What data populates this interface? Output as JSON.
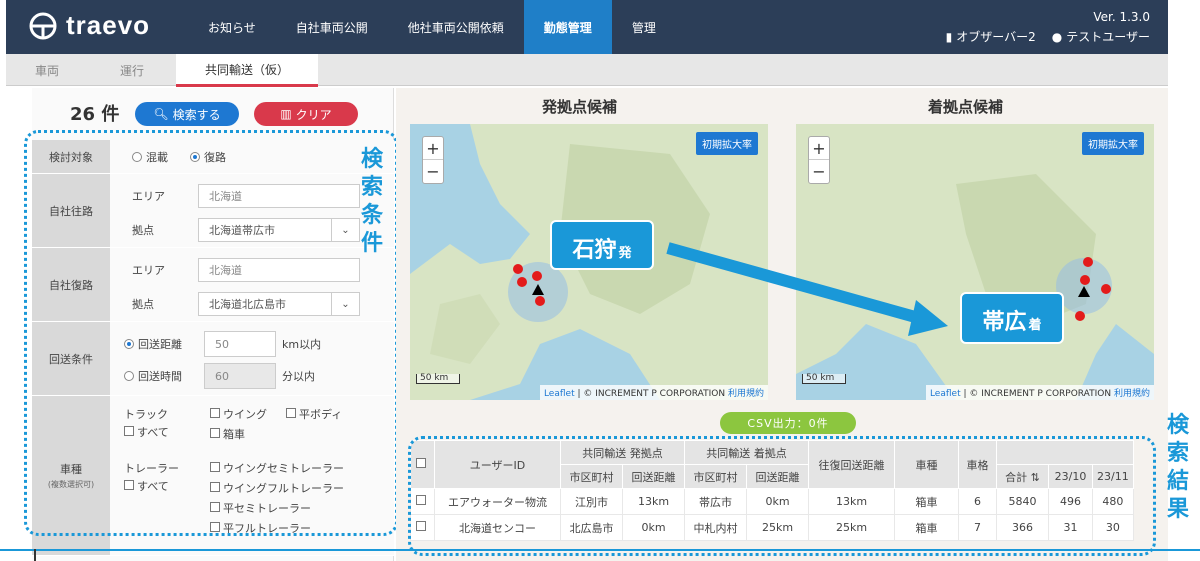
{
  "header": {
    "logo_text": "traevo",
    "version": "Ver. 1.3.0",
    "nav": [
      "お知らせ",
      "自社車両公開",
      "他社車両公開依頼",
      "勤態管理",
      "管理"
    ],
    "active_nav": "勤態管理",
    "observer": "オブザーバー2",
    "user": "テストユーザー"
  },
  "subtabs": [
    "車両",
    "運行",
    "共同輸送（仮）"
  ],
  "search": {
    "count": "26 件",
    "search_button": "検索する",
    "clear_button": "クリア"
  },
  "form": {
    "target_label": "検討対象",
    "target_options": [
      "混載",
      "復路"
    ],
    "outbound_label": "自社往路",
    "inbound_label": "自社復路",
    "area_label": "エリア",
    "base_label": "拠点",
    "outbound_area": "北海道",
    "outbound_base": "北海道帯広市",
    "inbound_area": "北海道",
    "inbound_base": "北海道北広島市",
    "return_label": "回送条件",
    "return_distance_label": "回送距離",
    "return_distance_value": "50",
    "return_distance_unit": "km以内",
    "return_time_label": "回送時間",
    "return_time_value": "60",
    "return_time_unit": "分以内",
    "vehicle_label": "車種",
    "vehicle_sub": "(複数選択可)",
    "truck_label": "トラック",
    "truck_all": "すべて",
    "truck_opts": [
      "ウイング",
      "平ボディ",
      "箱車"
    ],
    "trailer_label": "トレーラー",
    "trailer_all": "すべて",
    "trailer_opts": [
      "ウイングセミトレーラー",
      "ウイングフルトレーラー",
      "平セミトレーラー",
      "平フルトレーラー"
    ]
  },
  "annotations": {
    "search_conditions": [
      "検",
      "索",
      "条",
      "件"
    ],
    "search_results": [
      "検",
      "索",
      "結",
      "果"
    ]
  },
  "maps": {
    "left_title": "発拠点候補",
    "right_title": "着拠点候補",
    "reset_zoom": "初期拡大率",
    "zoom_in": "+",
    "zoom_out": "−",
    "scale": "50 km",
    "attrib_leaflet": "Leaflet",
    "attrib_text": " | © INCREMENT P CORPORATION ",
    "attrib_terms": "利用規約",
    "callout_from_big": "石狩",
    "callout_from_small": "発",
    "callout_to_big": "帯広",
    "callout_to_small": "着"
  },
  "csv_button": "CSV出力：0件",
  "table": {
    "headers": {
      "user_id": "ユーザーID",
      "from_group": "共同輸送 発拠点",
      "to_group": "共同輸送 着拠点",
      "city": "市区町村",
      "return_dist": "回送距離",
      "round_dist": "往復回送距離",
      "vehicle_type": "車種",
      "vehicle_size": "車格",
      "total": "合計 ⇅",
      "m1": "23/10",
      "m2": "23/11"
    },
    "rows": [
      {
        "user": "エアウォーター物流",
        "from_city": "江別市",
        "from_dist": "13km",
        "to_city": "帯広市",
        "to_dist": "0km",
        "round": "13km",
        "type": "箱車",
        "size": "6",
        "total": "5840",
        "m1": "496",
        "m2": "480"
      },
      {
        "user": "北海道センコー",
        "from_city": "北広島市",
        "from_dist": "0km",
        "to_city": "中札内村",
        "to_dist": "25km",
        "round": "25km",
        "type": "箱車",
        "size": "7",
        "total": "366",
        "m1": "31",
        "m2": "30"
      }
    ]
  }
}
